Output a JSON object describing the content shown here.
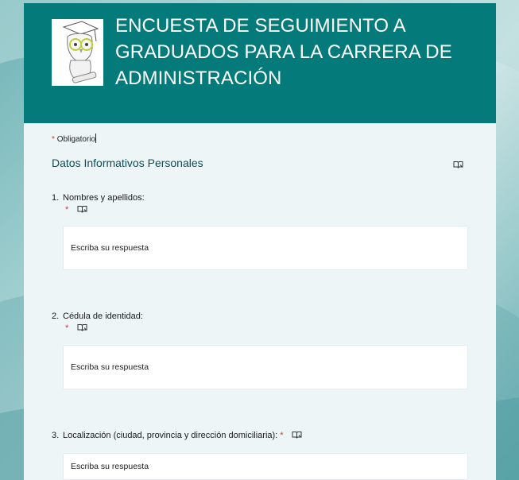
{
  "form": {
    "title_lines": [
      "ENCUESTA DE SEGUIMIENTO A",
      "GRADUADOS PARA LA CARRERA DE",
      "ADMINISTRACIÓN"
    ],
    "required_note": "Obligatorio",
    "required_star": "*",
    "section_title": "Datos Informativos Personales",
    "colors": {
      "header": "#047a7a",
      "accent": "#0b4e58",
      "required": "#c43b3b"
    }
  },
  "questions": [
    {
      "number": "1.",
      "label": "Nombres y apellidos:",
      "placeholder": "Escriba su respuesta",
      "required": "*"
    },
    {
      "number": "2.",
      "label": "Cédula de identidad:",
      "placeholder": "Escriba su respuesta",
      "required": "*"
    },
    {
      "number": "3.",
      "label": "Localización (ciudad, provincia y dirección domiciliaria):",
      "placeholder": "Escriba su respuesta",
      "required": "*"
    }
  ],
  "icons": {
    "reader": "immersive-reader-icon",
    "logo": "graduate-owl-logo"
  }
}
